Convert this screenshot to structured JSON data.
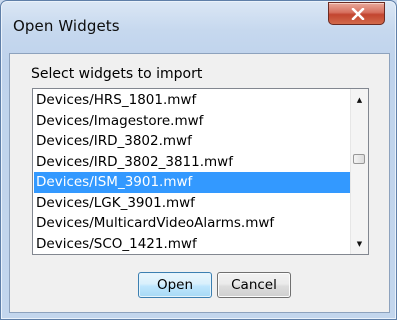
{
  "window": {
    "title": "Open Widgets"
  },
  "dialog": {
    "prompt": "Select widgets to import",
    "items": [
      "Devices/HRS_1801.mwf",
      "Devices/Imagestore.mwf",
      "Devices/IRD_3802.mwf",
      "Devices/IRD_3802_3811.mwf",
      "Devices/ISM_3901.mwf",
      "Devices/LGK_3901.mwf",
      "Devices/MulticardVideoAlarms.mwf",
      "Devices/SCO_1421.mwf"
    ],
    "selected_item": "Devices/ISM_3901.mwf",
    "scroll_up_arrow": "▲",
    "scroll_down_arrow": "▼",
    "open_label": "Open",
    "cancel_label": "Cancel"
  },
  "colors": {
    "selection": "#3399ff",
    "close_button": "#c75744",
    "title_bar": "#c6d8ee"
  }
}
